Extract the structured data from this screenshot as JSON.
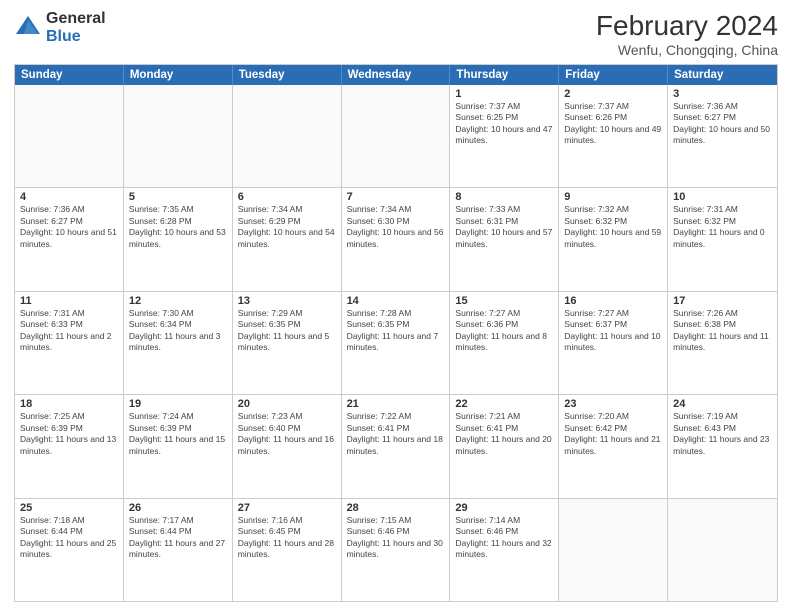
{
  "logo": {
    "general": "General",
    "blue": "Blue"
  },
  "title": {
    "month": "February 2024",
    "location": "Wenfu, Chongqing, China"
  },
  "header_days": [
    "Sunday",
    "Monday",
    "Tuesday",
    "Wednesday",
    "Thursday",
    "Friday",
    "Saturday"
  ],
  "weeks": [
    [
      {
        "day": "",
        "info": ""
      },
      {
        "day": "",
        "info": ""
      },
      {
        "day": "",
        "info": ""
      },
      {
        "day": "",
        "info": ""
      },
      {
        "day": "1",
        "info": "Sunrise: 7:37 AM\nSunset: 6:25 PM\nDaylight: 10 hours and 47 minutes."
      },
      {
        "day": "2",
        "info": "Sunrise: 7:37 AM\nSunset: 6:26 PM\nDaylight: 10 hours and 49 minutes."
      },
      {
        "day": "3",
        "info": "Sunrise: 7:36 AM\nSunset: 6:27 PM\nDaylight: 10 hours and 50 minutes."
      }
    ],
    [
      {
        "day": "4",
        "info": "Sunrise: 7:36 AM\nSunset: 6:27 PM\nDaylight: 10 hours and 51 minutes."
      },
      {
        "day": "5",
        "info": "Sunrise: 7:35 AM\nSunset: 6:28 PM\nDaylight: 10 hours and 53 minutes."
      },
      {
        "day": "6",
        "info": "Sunrise: 7:34 AM\nSunset: 6:29 PM\nDaylight: 10 hours and 54 minutes."
      },
      {
        "day": "7",
        "info": "Sunrise: 7:34 AM\nSunset: 6:30 PM\nDaylight: 10 hours and 56 minutes."
      },
      {
        "day": "8",
        "info": "Sunrise: 7:33 AM\nSunset: 6:31 PM\nDaylight: 10 hours and 57 minutes."
      },
      {
        "day": "9",
        "info": "Sunrise: 7:32 AM\nSunset: 6:32 PM\nDaylight: 10 hours and 59 minutes."
      },
      {
        "day": "10",
        "info": "Sunrise: 7:31 AM\nSunset: 6:32 PM\nDaylight: 11 hours and 0 minutes."
      }
    ],
    [
      {
        "day": "11",
        "info": "Sunrise: 7:31 AM\nSunset: 6:33 PM\nDaylight: 11 hours and 2 minutes."
      },
      {
        "day": "12",
        "info": "Sunrise: 7:30 AM\nSunset: 6:34 PM\nDaylight: 11 hours and 3 minutes."
      },
      {
        "day": "13",
        "info": "Sunrise: 7:29 AM\nSunset: 6:35 PM\nDaylight: 11 hours and 5 minutes."
      },
      {
        "day": "14",
        "info": "Sunrise: 7:28 AM\nSunset: 6:35 PM\nDaylight: 11 hours and 7 minutes."
      },
      {
        "day": "15",
        "info": "Sunrise: 7:27 AM\nSunset: 6:36 PM\nDaylight: 11 hours and 8 minutes."
      },
      {
        "day": "16",
        "info": "Sunrise: 7:27 AM\nSunset: 6:37 PM\nDaylight: 11 hours and 10 minutes."
      },
      {
        "day": "17",
        "info": "Sunrise: 7:26 AM\nSunset: 6:38 PM\nDaylight: 11 hours and 11 minutes."
      }
    ],
    [
      {
        "day": "18",
        "info": "Sunrise: 7:25 AM\nSunset: 6:39 PM\nDaylight: 11 hours and 13 minutes."
      },
      {
        "day": "19",
        "info": "Sunrise: 7:24 AM\nSunset: 6:39 PM\nDaylight: 11 hours and 15 minutes."
      },
      {
        "day": "20",
        "info": "Sunrise: 7:23 AM\nSunset: 6:40 PM\nDaylight: 11 hours and 16 minutes."
      },
      {
        "day": "21",
        "info": "Sunrise: 7:22 AM\nSunset: 6:41 PM\nDaylight: 11 hours and 18 minutes."
      },
      {
        "day": "22",
        "info": "Sunrise: 7:21 AM\nSunset: 6:41 PM\nDaylight: 11 hours and 20 minutes."
      },
      {
        "day": "23",
        "info": "Sunrise: 7:20 AM\nSunset: 6:42 PM\nDaylight: 11 hours and 21 minutes."
      },
      {
        "day": "24",
        "info": "Sunrise: 7:19 AM\nSunset: 6:43 PM\nDaylight: 11 hours and 23 minutes."
      }
    ],
    [
      {
        "day": "25",
        "info": "Sunrise: 7:18 AM\nSunset: 6:44 PM\nDaylight: 11 hours and 25 minutes."
      },
      {
        "day": "26",
        "info": "Sunrise: 7:17 AM\nSunset: 6:44 PM\nDaylight: 11 hours and 27 minutes."
      },
      {
        "day": "27",
        "info": "Sunrise: 7:16 AM\nSunset: 6:45 PM\nDaylight: 11 hours and 28 minutes."
      },
      {
        "day": "28",
        "info": "Sunrise: 7:15 AM\nSunset: 6:46 PM\nDaylight: 11 hours and 30 minutes."
      },
      {
        "day": "29",
        "info": "Sunrise: 7:14 AM\nSunset: 6:46 PM\nDaylight: 11 hours and 32 minutes."
      },
      {
        "day": "",
        "info": ""
      },
      {
        "day": "",
        "info": ""
      }
    ]
  ]
}
